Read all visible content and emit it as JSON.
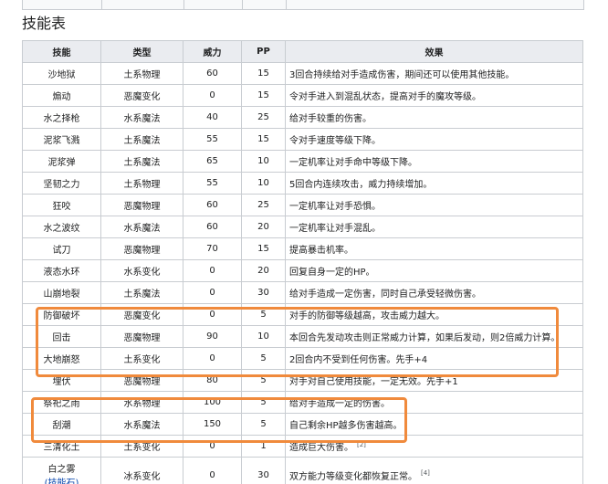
{
  "heading": "技能表",
  "table": {
    "headers": {
      "name": "技能",
      "type": "类型",
      "power": "威力",
      "pp": "PP",
      "effect": "效果"
    },
    "rows": [
      {
        "name": "沙地狱",
        "type": "土系物理",
        "power": "60",
        "pp": "15",
        "effect": "3回合持续给对手造成伤害，期间还可以使用其他技能。"
      },
      {
        "name": "煽动",
        "type": "恶魔变化",
        "power": "0",
        "pp": "15",
        "effect": "令对手进入到混乱状态，提高对手的魔攻等级。"
      },
      {
        "name": "水之择枪",
        "type": "水系魔法",
        "power": "40",
        "pp": "25",
        "effect": "给对手较重的伤害。"
      },
      {
        "name": "泥浆飞溅",
        "type": "土系魔法",
        "power": "55",
        "pp": "15",
        "effect": "令对手速度等级下降。"
      },
      {
        "name": "泥浆弹",
        "type": "土系魔法",
        "power": "65",
        "pp": "10",
        "effect": "一定机率让对手命中等级下降。"
      },
      {
        "name": "坚韧之力",
        "type": "土系物理",
        "power": "55",
        "pp": "10",
        "effect": "5回合内连续攻击，威力持续增加。"
      },
      {
        "name": "狂咬",
        "type": "恶魔物理",
        "power": "60",
        "pp": "25",
        "effect": "一定机率让对手恐惧。"
      },
      {
        "name": "水之波纹",
        "type": "水系魔法",
        "power": "60",
        "pp": "20",
        "effect": "一定机率让对手混乱。"
      },
      {
        "name": "试刀",
        "type": "恶魔物理",
        "power": "70",
        "pp": "15",
        "effect": "提高暴击机率。"
      },
      {
        "name": "液态水环",
        "type": "水系变化",
        "power": "0",
        "pp": "20",
        "effect": "回复自身一定的HP。"
      },
      {
        "name": "山崩地裂",
        "type": "土系魔法",
        "power": "0",
        "pp": "30",
        "effect": "给对手造成一定伤害，同时自己承受轻微伤害。"
      },
      {
        "name": "防御破坏",
        "type": "恶魔变化",
        "power": "0",
        "pp": "5",
        "effect": "对手的防御等级越高，攻击威力越大。"
      },
      {
        "name": "回击",
        "type": "恶魔物理",
        "power": "90",
        "pp": "10",
        "effect": "本回合先发动攻击则正常威力计算，如果后发动，则2倍威力计算。"
      },
      {
        "name": "大地崩怒",
        "type": "土系变化",
        "power": "0",
        "pp": "5",
        "effect": "2回合内不受到任何伤害。先手+4"
      },
      {
        "name": "埋伏",
        "type": "恶魔物理",
        "power": "80",
        "pp": "5",
        "effect": "对手对自己使用技能，一定无效。先手+1"
      },
      {
        "name": "祭祀之雨",
        "type": "水系物理",
        "power": "100",
        "pp": "5",
        "effect": "给对手造成一定的伤害。"
      },
      {
        "name": "刮潮",
        "type": "水系魔法",
        "power": "150",
        "pp": "5",
        "effect": "自己剩余HP越多伤害越高。"
      },
      {
        "name": "三清化土",
        "type": "土系变化",
        "power": "0",
        "pp": "1",
        "effect": "造成巨大伤害。",
        "ref": "[2]"
      },
      {
        "name": "白之雾",
        "name_link": "(技能石)",
        "type": "冰系变化",
        "power": "0",
        "pp": "30",
        "effect": "双方能力等级变化都恢复正常。",
        "ref": "[4]"
      }
    ]
  },
  "highlight_color": "#f08a3c"
}
